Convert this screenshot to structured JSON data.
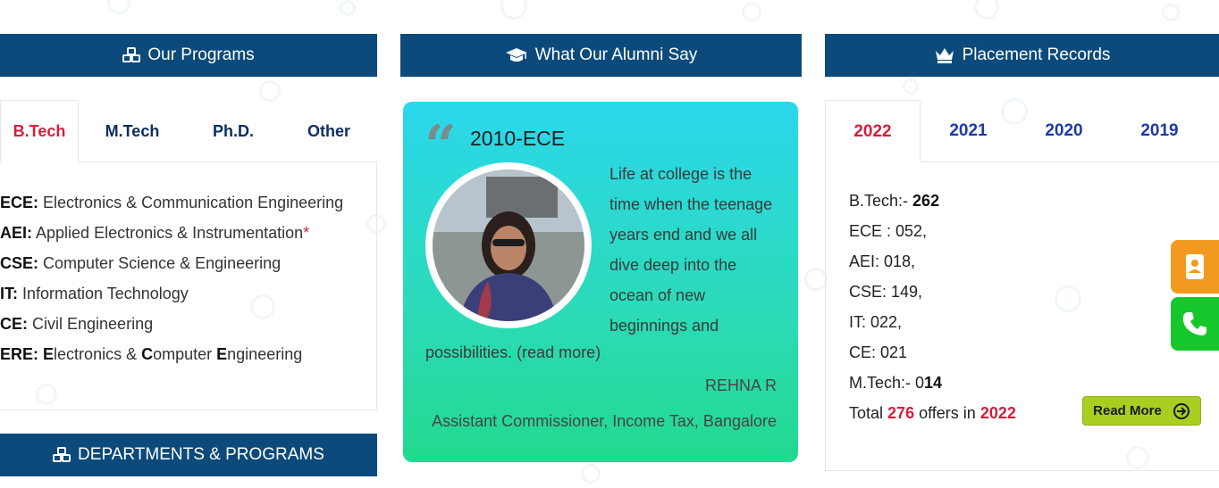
{
  "programs": {
    "title": "Our Programs",
    "tabs": [
      {
        "label": "B.Tech",
        "active": true
      },
      {
        "label": "M.Tech",
        "active": false
      },
      {
        "label": "Ph.D.",
        "active": false
      },
      {
        "label": "Other",
        "active": false
      }
    ],
    "items": [
      {
        "code": "ECE:",
        "name": "Electronics & Communication Engineering"
      },
      {
        "code": "AEI:",
        "name": "Applied Electronics & Instrumentation",
        "mark": "*"
      },
      {
        "code": "CSE:",
        "name": "Computer Science & Engineering"
      },
      {
        "code": "IT:",
        "name": "Information Technology"
      },
      {
        "code": "CE:",
        "name": "Civil Engineering"
      },
      {
        "code": "ERE:",
        "name_parts": [
          "E",
          "lectronics & ",
          "C",
          "omputer ",
          "E",
          "ngineering"
        ]
      }
    ]
  },
  "departments": {
    "title": "DEPARTMENTS & PROGRAMS"
  },
  "alumni": {
    "title": "What Our Alumni Say",
    "batch": "2010-ECE",
    "quote_lines": [
      "Life at college is the",
      "time when the teenage",
      "years end and we all",
      "dive deep into the",
      "ocean of new",
      "beginnings and"
    ],
    "quote_tail": "possibilities.",
    "read_more": "(read more)",
    "name": "REHNA R",
    "role": "Assistant Commissioner, Income Tax, Bangalore"
  },
  "placement": {
    "title": "Placement Records",
    "tabs": [
      {
        "label": "2022",
        "active": true
      },
      {
        "label": "2021",
        "active": false
      },
      {
        "label": "2020",
        "active": false
      },
      {
        "label": "2019",
        "active": false
      }
    ],
    "btech_label": "B.Tech:-",
    "btech_value": "262",
    "lines": [
      "ECE : 052,",
      "AEI: 018,",
      "CSE: 149,",
      "IT: 022,",
      "CE: 021"
    ],
    "mtech_label": "M.Tech:- 0",
    "mtech_value": "14",
    "total_prefix": "Total",
    "total_value": "276",
    "total_mid": "offers in",
    "total_year": "2022",
    "read_more": "Read More"
  },
  "colors": {
    "header": "#0b4a7a",
    "accent_red": "#d21f3c",
    "button_green": "#a8cf1f",
    "contact_orange": "#f29a1f",
    "call_green": "#16c72c"
  },
  "icons": {
    "programs": "cubes-icon",
    "alumni": "graduation-cap-icon",
    "placement": "crown-icon",
    "contact": "address-book-icon",
    "call": "phone-icon",
    "read_more": "arrow-circle-right-icon",
    "quote": "quote-left-icon"
  }
}
